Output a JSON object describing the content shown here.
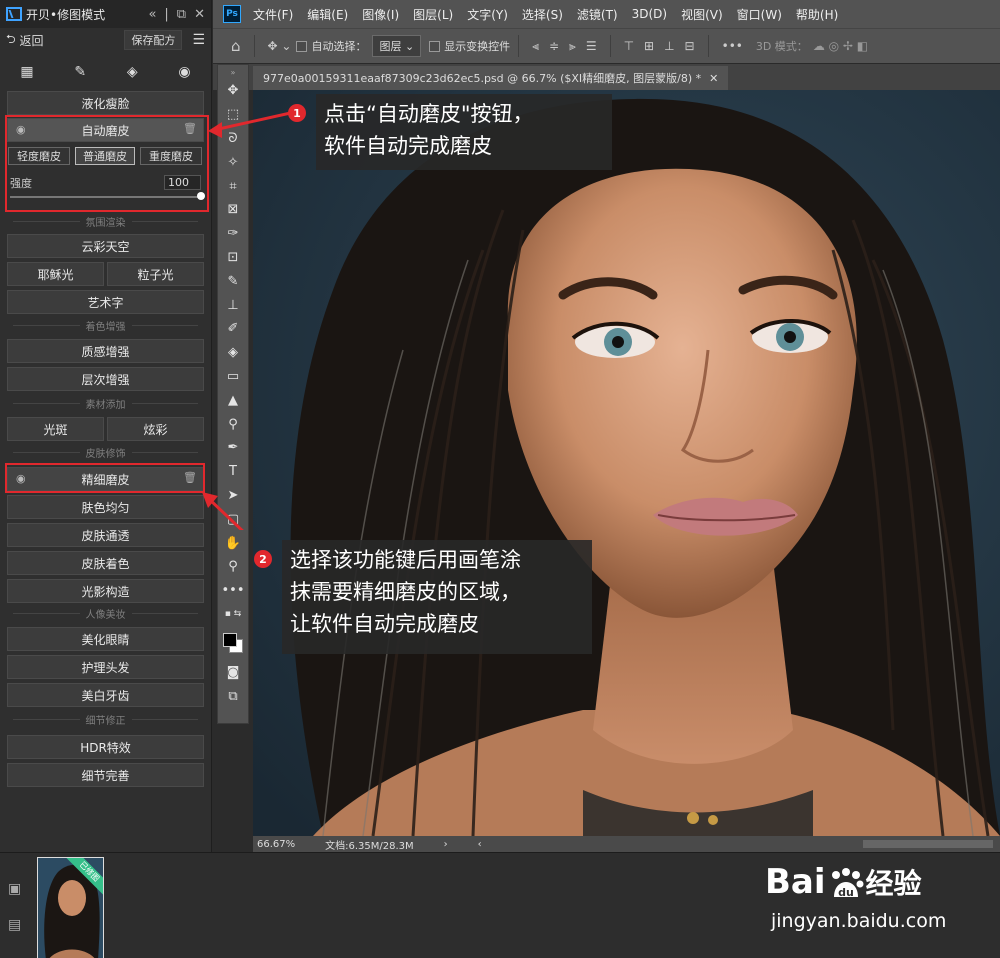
{
  "plugin": {
    "title": "开贝•修图模式",
    "back_label": "返回",
    "save_label": "保存配方",
    "auto_skin": {
      "label": "自动磨皮",
      "options": [
        "轻度磨皮",
        "普通磨皮",
        "重度磨皮"
      ],
      "active": "普通磨皮",
      "strength_label": "强度",
      "strength_value": "100"
    },
    "buttons": {
      "liquify": "液化瘦脸",
      "cloud_sky": "云彩天空",
      "jesus_light": "耶稣光",
      "particle_light": "粒子光",
      "art_text": "艺术字",
      "texture": "质感增强",
      "layer": "层次增强",
      "flare": "光斑",
      "dazzle": "炫彩",
      "fine_skin": "精细磨皮",
      "even_skin": "肤色均匀",
      "skin_clear": "皮肤通透",
      "skin_color": "皮肤着色",
      "light_shadow": "光影构造",
      "eyes": "美化眼睛",
      "hair": "护理头发",
      "teeth": "美白牙齿",
      "hdr": "HDR特效",
      "detail": "细节完善"
    },
    "sections": {
      "atmosphere": "氛围渲染",
      "color": "着色增强",
      "material": "素材添加",
      "skin": "皮肤修饰",
      "portrait": "人像美妆",
      "detail": "细节修正"
    }
  },
  "ps": {
    "logo": "Ps",
    "menu": [
      "文件(F)",
      "编辑(E)",
      "图像(I)",
      "图层(L)",
      "文字(Y)",
      "选择(S)",
      "滤镜(T)",
      "3D(D)",
      "视图(V)",
      "窗口(W)",
      "帮助(H)"
    ],
    "options": {
      "auto_select": "自动选择：",
      "layer_select": "图层",
      "show_transform": "显示变换控件",
      "mode3d": "3D 模式："
    },
    "tab_title": "977e0a00159311eaaf87309c23d62ec5.psd @ 66.7% ($XI精细磨皮, 图层蒙版/8) *",
    "status_zoom": "66.67%",
    "status_doc": "文档:6.35M/28.3M"
  },
  "annotations": {
    "a1_num": "1",
    "a1_line1": "点击“自动磨皮\"按钮，",
    "a1_line2": "软件自动完成磨皮",
    "a2_num": "2",
    "a2_line1": "选择该功能键后用画笔涂",
    "a2_line2": "抹需要精细磨皮的区域，",
    "a2_line3": "让软件自动完成磨皮"
  },
  "thumb_flag": "已修图",
  "watermark": {
    "brand": "Bai",
    "brand_cn": "经验",
    "url": "jingyan.baidu.com"
  },
  "colors": {
    "highlight": "#e1282d",
    "panel_bg": "#2f2f2f",
    "ps_chrome": "#535353"
  }
}
